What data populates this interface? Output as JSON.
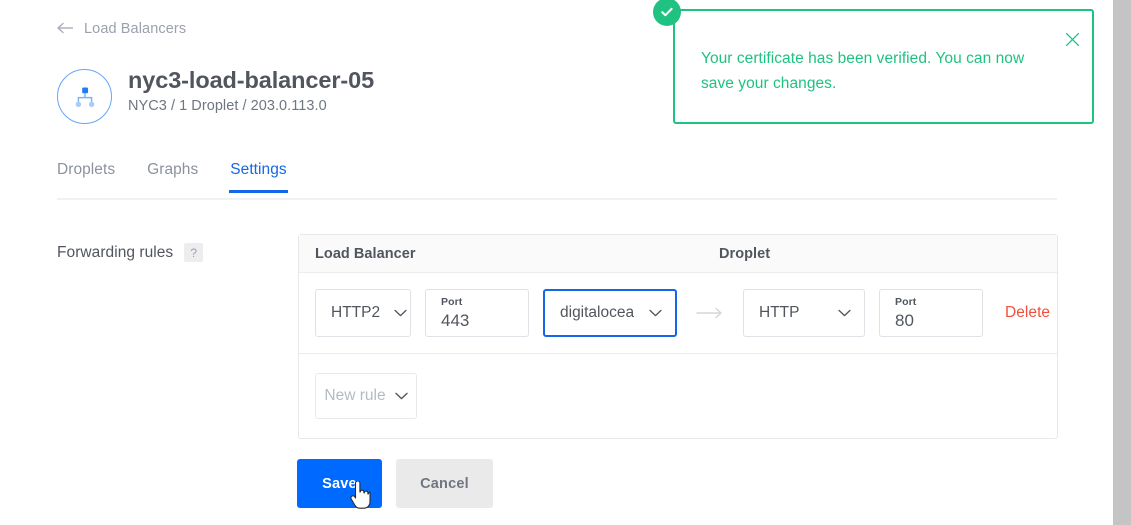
{
  "breadcrumb": {
    "back_icon": "arrow-left-icon",
    "label": "Load Balancers"
  },
  "header": {
    "avatar_icon": "load-balancer-node-icon",
    "title": "nyc3-load-balancer-05",
    "subtitle": "NYC3 / 1 Droplet / 203.0.113.0"
  },
  "notification": {
    "status_icon": "check-circle-icon",
    "message": "Your certificate has been verified. You can now save your changes.",
    "close_icon": "close-icon",
    "accent_color": "#1fc281"
  },
  "tabs": [
    {
      "label": "Droplets",
      "active": false
    },
    {
      "label": "Graphs",
      "active": false
    },
    {
      "label": "Settings",
      "active": true
    }
  ],
  "forwarding": {
    "label": "Forwarding rules",
    "help_icon": "question-mark-icon",
    "help_text": "?",
    "columns": {
      "load_balancer": "Load Balancer",
      "droplet": "Droplet"
    },
    "rules": [
      {
        "lb_protocol": "HTTP2",
        "lb_port_label": "Port",
        "lb_port_value": "443",
        "certificate": "digitalocea",
        "certificate_focused": true,
        "arrow_icon": "arrow-right-icon",
        "droplet_protocol": "HTTP",
        "droplet_port_label": "Port",
        "droplet_port_value": "80",
        "delete_label": "Delete"
      }
    ],
    "new_rule_label": "New rule",
    "chevron_icon": "chevron-down-icon"
  },
  "actions": {
    "save_label": "Save",
    "cancel_label": "Cancel",
    "save_color": "#0069ff"
  }
}
